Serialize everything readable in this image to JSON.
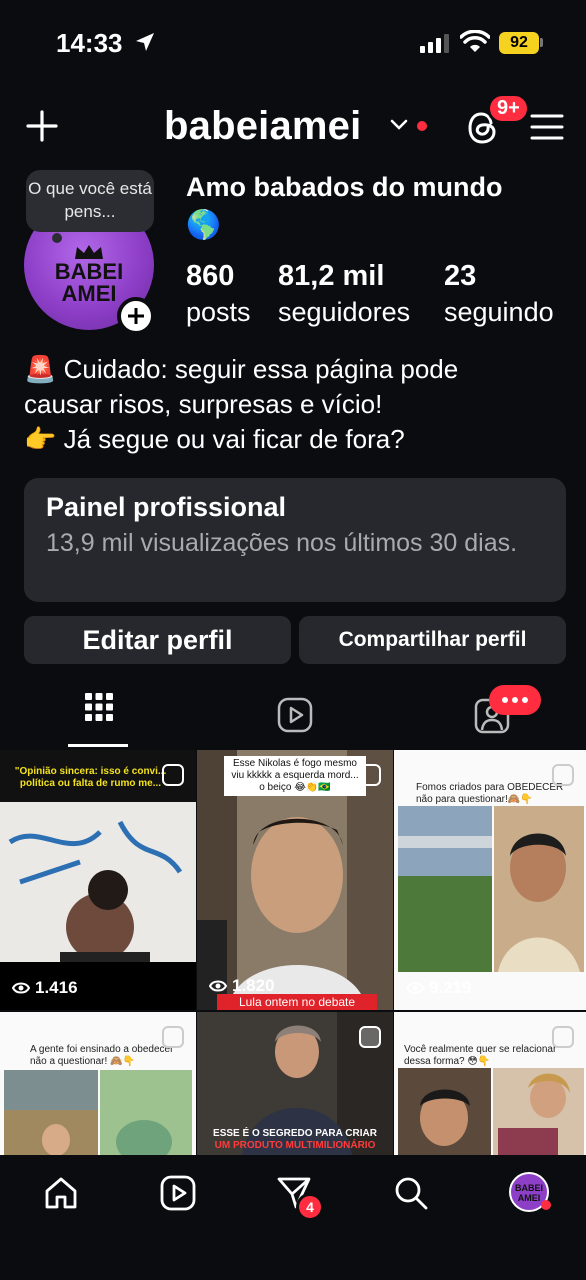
{
  "status_bar": {
    "time": "14:33",
    "battery": "92"
  },
  "header": {
    "username": "babeiamei",
    "notif_badge": "9+"
  },
  "profile": {
    "note_bubble": "O que você está pens...",
    "avatar_text_line1": "BABEI",
    "avatar_text_line2": "AMEI",
    "name": "Amo babados do mundo",
    "name_emoji": "🌎",
    "stats": [
      {
        "value": "860",
        "label": "posts"
      },
      {
        "value": "81,2 mil",
        "label": "seguidores"
      },
      {
        "value": "23",
        "label": "seguindo"
      }
    ],
    "bio_line1": "🚨 Cuidado: seguir essa página pode",
    "bio_line2": "causar risos, surpresas e vício!",
    "bio_line3": "👉 Já segue ou vai ficar de fora?"
  },
  "dashboard": {
    "title": "Painel profissional",
    "subtitle": "13,9 mil visualizações nos últimos 30 dias."
  },
  "buttons": {
    "edit": "Editar perfil",
    "share": "Compartilhar perfil"
  },
  "tabs": {
    "active": "grid",
    "icons": [
      "grid-icon",
      "reels-icon",
      "tagged-icon"
    ]
  },
  "posts": [
    {
      "caption": "\"Opinião sincera: isso é convi... política ou falta de rumo me...",
      "views": "1.416"
    },
    {
      "caption": "Esse Nikolas é fogo mesmo viu kkkkk a esquerda mord... o beiço 😂👏🇧🇷",
      "views": "1.820",
      "subcaption": "Lula ontem no debate"
    },
    {
      "caption": "Fomos criados para OBEDECER não para questionar!🙈👇",
      "views": "9.219"
    },
    {
      "caption": "A gente foi ensinado a obedecer não a questionar! 🙈👇"
    },
    {
      "caption": "ESSE É O SEGREDO PARA CRIAR",
      "caption2": "UM PRODUTO MULTIMILIONÁRIO"
    },
    {
      "caption": "Você realmente quer se relacionar dessa forma? 😳👇"
    }
  ],
  "bottom_nav": {
    "messages_badge": "4",
    "profile_avatar_text": "BABEI AMEI"
  },
  "colors": {
    "background": "#0b0c10",
    "card": "#26282e",
    "accent_red": "#ff2d3f",
    "avatar_purple": "#8e3fc8",
    "battery": "#f5d21f"
  }
}
